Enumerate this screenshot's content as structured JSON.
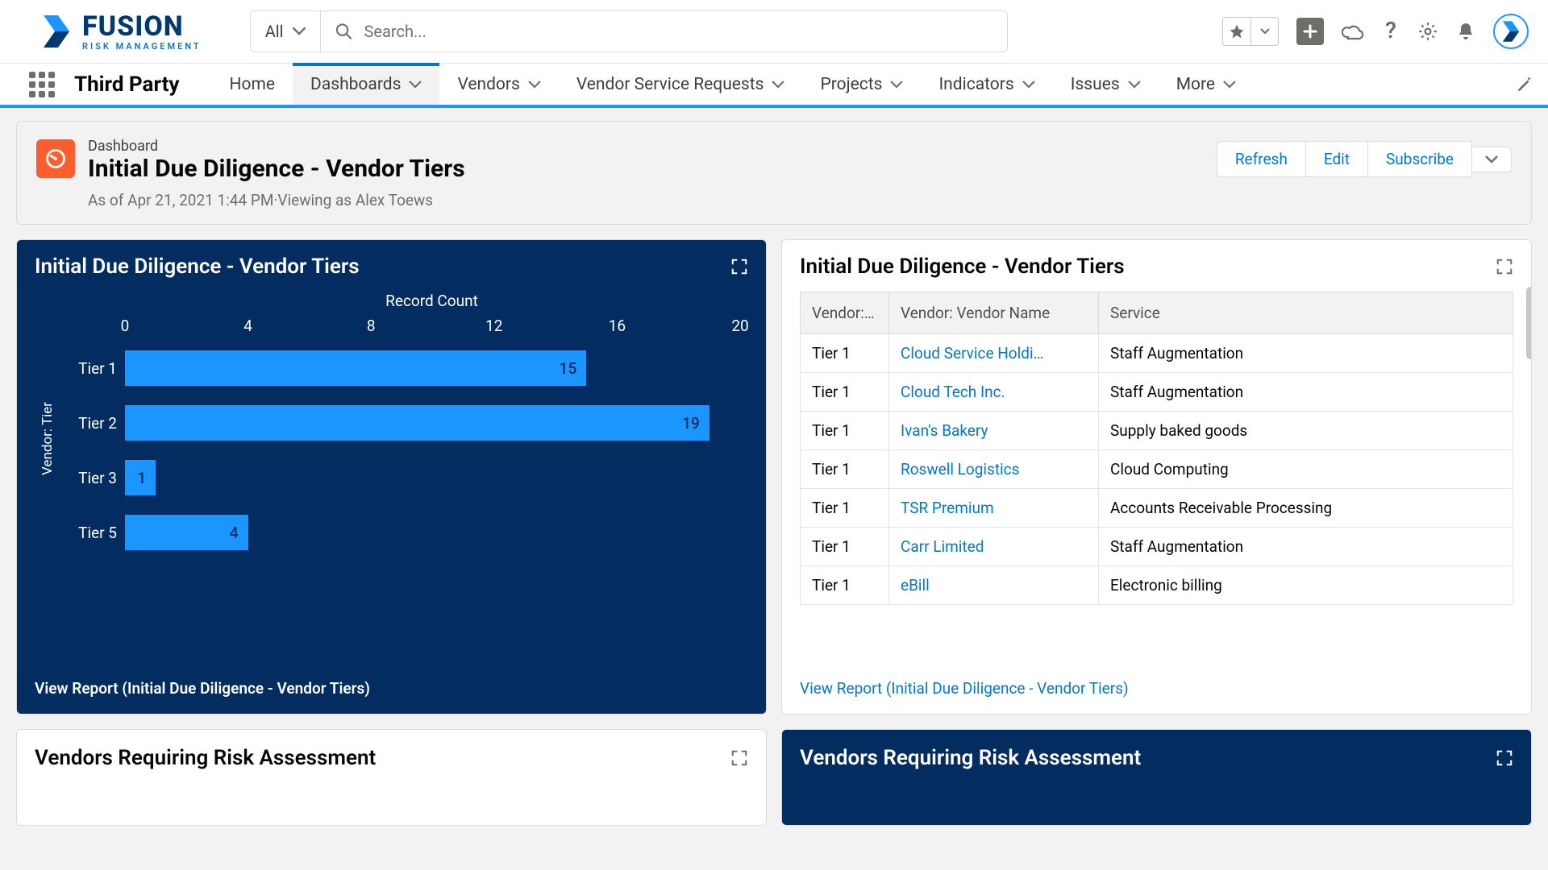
{
  "brand": {
    "name": "FUSION",
    "tagline": "RISK MANAGEMENT"
  },
  "search": {
    "scope": "All",
    "placeholder": "Search..."
  },
  "nav": {
    "app_name": "Third Party",
    "tabs": [
      "Home",
      "Dashboards",
      "Vendors",
      "Vendor Service Requests",
      "Projects",
      "Indicators",
      "Issues",
      "More"
    ],
    "active_index": 1
  },
  "dashboard": {
    "kicker": "Dashboard",
    "title": "Initial Due Diligence - Vendor Tiers",
    "asof": "As of Apr 21, 2021 1:44 PM·Viewing as Alex Toews",
    "actions": {
      "refresh": "Refresh",
      "edit": "Edit",
      "subscribe": "Subscribe"
    }
  },
  "chart_widget": {
    "title": "Initial Due Diligence - Vendor Tiers",
    "view_report": "View Report (Initial Due Diligence - Vendor Tiers)"
  },
  "chart_data": {
    "type": "bar",
    "orientation": "horizontal",
    "title": "Initial Due Diligence - Vendor Tiers",
    "xlabel": "Record Count",
    "ylabel": "Vendor: Tier",
    "xlim": [
      0,
      20
    ],
    "x_ticks": [
      0,
      4,
      8,
      12,
      16,
      20
    ],
    "categories": [
      "Tier 1",
      "Tier 2",
      "Tier 3",
      "Tier 5"
    ],
    "values": [
      15,
      19,
      1,
      4
    ],
    "bar_color": "#1b96ff",
    "background": "#032d60"
  },
  "table_widget": {
    "title": "Initial Due Diligence - Vendor Tiers",
    "view_report": "View Report (Initial Due Diligence - Vendor Tiers)",
    "columns": [
      "Vendor:…",
      "Vendor: Vendor Name",
      "Service"
    ],
    "rows": [
      {
        "tier": "Tier 1",
        "name": "Cloud Service Holdi…",
        "service": "Staff Augmentation"
      },
      {
        "tier": "Tier 1",
        "name": "Cloud Tech Inc.",
        "service": "Staff Augmentation"
      },
      {
        "tier": "Tier 1",
        "name": "Ivan's Bakery",
        "service": "Supply baked goods"
      },
      {
        "tier": "Tier 1",
        "name": "Roswell Logistics",
        "service": "Cloud Computing"
      },
      {
        "tier": "Tier 1",
        "name": "TSR Premium",
        "service": "Accounts Receivable Processing"
      },
      {
        "tier": "Tier 1",
        "name": "Carr Limited",
        "service": "Staff Augmentation"
      },
      {
        "tier": "Tier 1",
        "name": "eBill",
        "service": "Electronic billing"
      }
    ]
  },
  "bottom_widgets": {
    "left_title": "Vendors Requiring Risk Assessment",
    "right_title": "Vendors Requiring Risk Assessment"
  }
}
